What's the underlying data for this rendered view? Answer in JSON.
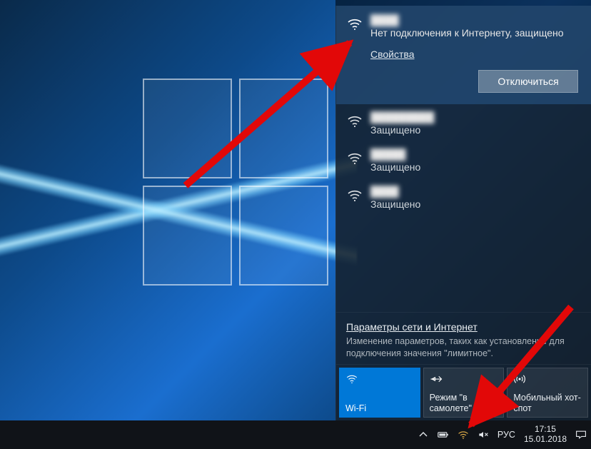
{
  "current_network": {
    "name": "████",
    "status": "Нет подключения к Интернету, защищено",
    "properties_label": "Свойства",
    "disconnect_label": "Отключиться"
  },
  "other_networks": [
    {
      "name": "█████████",
      "status": "Защищено"
    },
    {
      "name": "█████",
      "status": "Защищено"
    },
    {
      "name": "████",
      "status": "Защищено"
    }
  ],
  "settings": {
    "link": "Параметры сети и Интернет",
    "description": "Изменение параметров, таких как установление для подключения значения \"лимитное\"."
  },
  "tiles": {
    "wifi": "Wi-Fi",
    "airplane": "Режим \"в самолете\"",
    "hotspot": "Мобильный хот-спот"
  },
  "tray": {
    "lang": "РУС",
    "time": "17:15",
    "date": "15.01.2018"
  }
}
